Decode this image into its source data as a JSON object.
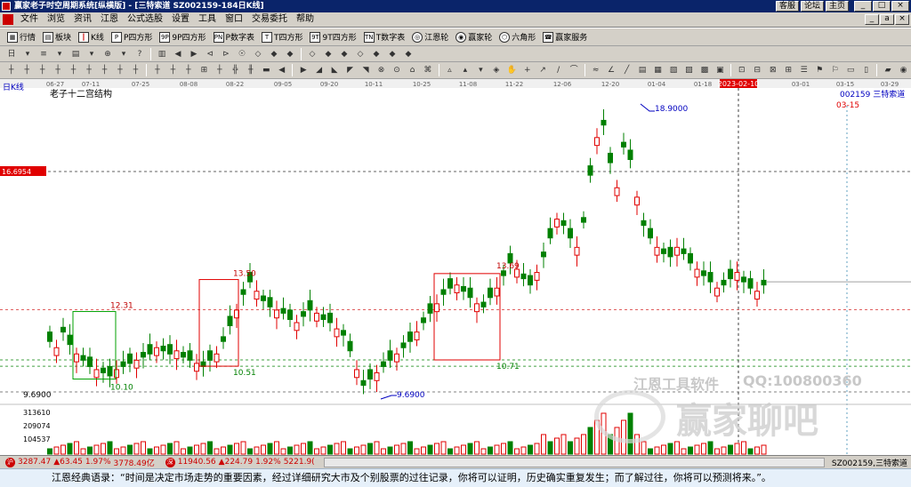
{
  "window": {
    "title": "赢家老子时空周期系统[纵横版] - [三特索道  SZ002159-184日K线]",
    "links": [
      "客服",
      "论坛",
      "主页"
    ],
    "buttons": [
      "_",
      "□",
      "×"
    ]
  },
  "menu": {
    "items": [
      "文件",
      "浏览",
      "资讯",
      "江恩",
      "公式选股",
      "设置",
      "工具",
      "窗口",
      "交易委托",
      "帮助"
    ],
    "right_buttons": [
      "_",
      "a",
      "×"
    ]
  },
  "toolbar1": {
    "items": [
      {
        "label": "行情",
        "icon": "grid"
      },
      {
        "label": "板块",
        "icon": "blocks"
      },
      {
        "label": "K线",
        "icon": "kline"
      },
      {
        "label": "P四方形",
        "icon": "P"
      },
      {
        "label": "9P四方形",
        "icon": "9P"
      },
      {
        "label": "P数字表",
        "icon": "PN"
      },
      {
        "label": "T四方形",
        "icon": "T"
      },
      {
        "label": "9T四方形",
        "icon": "9T"
      },
      {
        "label": "T数字表",
        "icon": "TN"
      },
      {
        "label": "江恩轮",
        "icon": "wheel"
      },
      {
        "label": "赢家轮",
        "icon": "wheel2"
      },
      {
        "label": "六角形",
        "icon": "hex"
      },
      {
        "label": "赢家服务",
        "icon": "service"
      }
    ]
  },
  "chart": {
    "period_label": "日K线",
    "indicator_name": "老子十二宫结构",
    "stock_label": "002159 三特索道",
    "date_marker": "03-15",
    "cursor_date": "2023-02-10",
    "cursor_price": "16.6954",
    "dates": [
      "06-27",
      "07-11",
      "07-25",
      "08-08",
      "08-22",
      "09-05",
      "09-20",
      "10-11",
      "10-25",
      "11-08",
      "11-22",
      "12-06",
      "12-20",
      "01-04",
      "01-18",
      "2023-02-10",
      "03-01",
      "03-15",
      "03-29"
    ],
    "price_labels": {
      "box1_high": "12.31",
      "box1_low": "10.10",
      "box2_high": "13.50",
      "box2_low": "10.51",
      "box3_high": "13.69",
      "box3_low": "10.71",
      "peak": "18.9000",
      "trough": "9.6900",
      "axis_low": "9.6900"
    },
    "volume_labels": [
      "313610",
      "209074",
      "104537"
    ],
    "colors": {
      "up": "#e00000",
      "down": "#008000",
      "box": "#e00000",
      "green_box": "#00a000",
      "annot": "#0000c0"
    }
  },
  "watermarks": {
    "tool": "江恩工具软件",
    "qq": "QQ:100800360",
    "brand": "赢家聊吧"
  },
  "status": {
    "sh_index": "3287.47",
    "sh_change": "▲63.45",
    "sh_pct": "1.97%",
    "sh_amount": "3778.49亿",
    "sz_index": "11940.56",
    "sz_change": "▲224.79",
    "sz_pct": "1.92%",
    "sz_amount": "5221.9(",
    "current_stock": "SZ002159,三特索道"
  },
  "quote": {
    "text": "江恩经典语录：“时间是决定市场走势的重要因素，经过详细研究大市及个别股票的过往记录，你将可以证明，历史确实重复发生；而了解过往，你将可以预测将来。”。"
  }
}
